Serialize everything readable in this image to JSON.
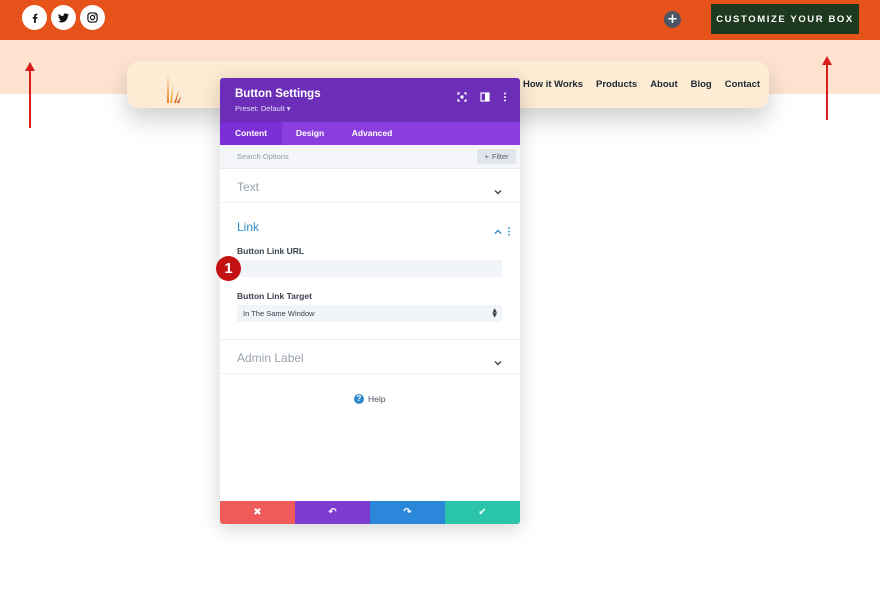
{
  "header": {
    "social_icons": [
      "facebook-icon",
      "twitter-icon",
      "instagram-icon"
    ],
    "add_icon": "+",
    "cta_label": "CUSTOMIZE YOUR BOX"
  },
  "nav": {
    "links": [
      "How it Works",
      "Products",
      "About",
      "Blog",
      "Contact"
    ]
  },
  "modal": {
    "title": "Button Settings",
    "preset": "Preset: Default ▾",
    "tabs": [
      "Content",
      "Design",
      "Advanced"
    ],
    "active_tab": "Content",
    "search_placeholder": "Search Options",
    "filter_label": "Filter",
    "filter_icon": "+",
    "sections": {
      "text": "Text",
      "link": "Link",
      "admin": "Admin Label"
    },
    "fields": {
      "url_label": "Button Link URL",
      "url_value": "",
      "target_label": "Button Link Target",
      "target_value": "In The Same Window"
    },
    "help_label": "Help",
    "help_icon": "?",
    "footer": {
      "cancel": "✖",
      "undo": "↶",
      "redo": "↷",
      "save": "✔"
    }
  },
  "annotation": {
    "badge": "1"
  },
  "colors": {
    "topbar": "#e5531a",
    "peach": "#fde3d0",
    "cta_bg": "#1e3a1e",
    "modal_header": "#6c2eb9",
    "modal_tabs": "#8a3ee0",
    "cancel": "#ef5b5b",
    "undo": "#7e3bd0",
    "redo": "#2b87da",
    "save": "#29c4a9",
    "arrow": "#d91c1c"
  }
}
